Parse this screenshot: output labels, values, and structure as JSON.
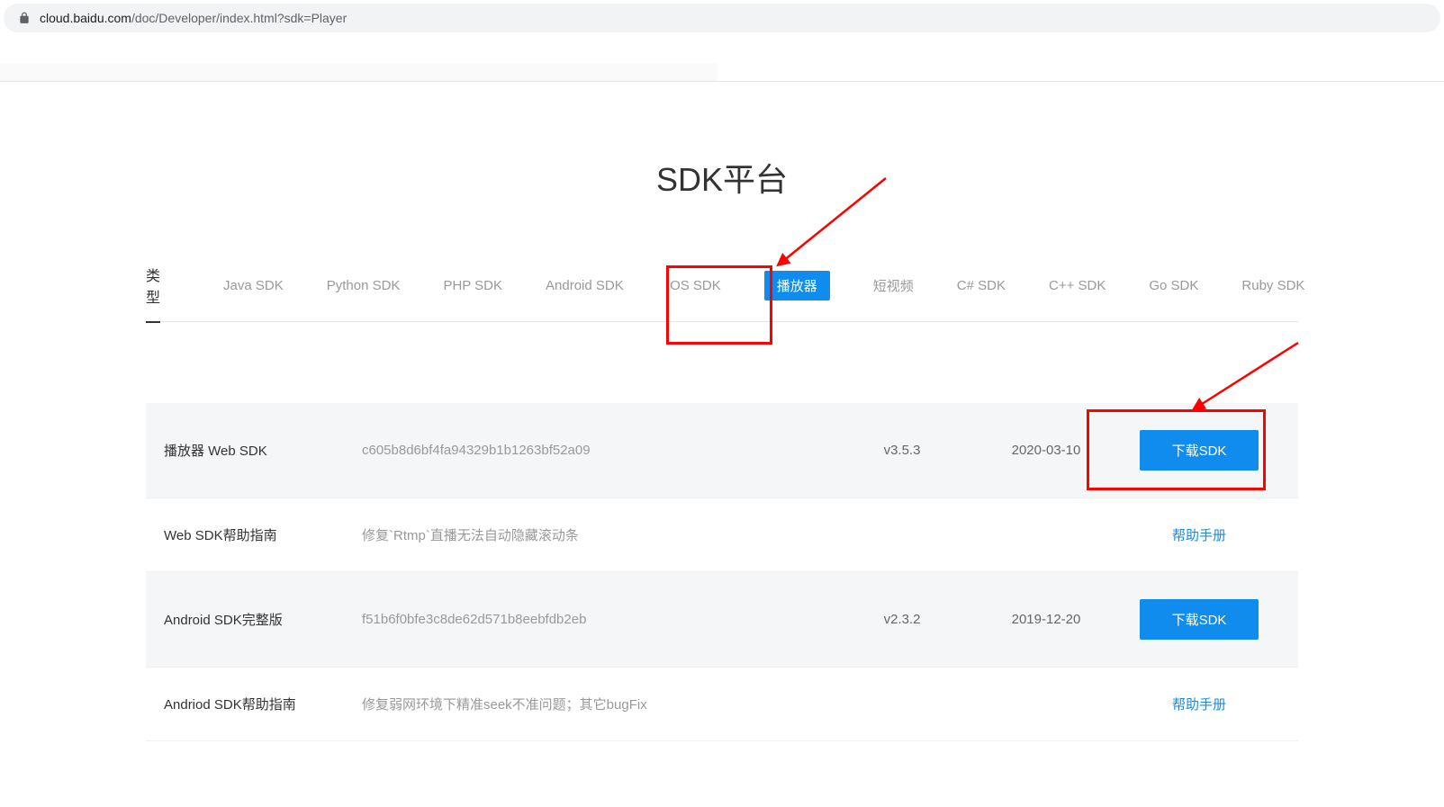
{
  "url": {
    "domain": "cloud.baidu.com",
    "path": "/doc/Developer/index.html?sdk=Player"
  },
  "page_title": "SDK平台",
  "type_label": "类型",
  "type_items": [
    {
      "label": "Java SDK",
      "active": false
    },
    {
      "label": "Python SDK",
      "active": false
    },
    {
      "label": "PHP SDK",
      "active": false
    },
    {
      "label": "Android SDK",
      "active": false
    },
    {
      "label": "iOS SDK",
      "active": false
    },
    {
      "label": "播放器",
      "active": true
    },
    {
      "label": "短视频",
      "active": false
    },
    {
      "label": "C# SDK",
      "active": false
    },
    {
      "label": "C++ SDK",
      "active": false
    },
    {
      "label": "Go SDK",
      "active": false
    },
    {
      "label": "Ruby SDK",
      "active": false
    }
  ],
  "rows": [
    {
      "name": "播放器 Web SDK",
      "desc": "c605b8d6bf4fa94329b1b1263bf52a09",
      "version": "v3.5.3",
      "date": "2020-03-10",
      "action_type": "download",
      "action_label": "下载SDK",
      "highlighted": true
    },
    {
      "name": "Web SDK帮助指南",
      "desc": "修复`Rtmp`直播无法自动隐藏滚动条",
      "version": "",
      "date": "",
      "action_type": "link",
      "action_label": "帮助手册",
      "highlighted": false
    },
    {
      "name": "Android SDK完整版",
      "desc": "f51b6f0bfe3c8de62d571b8eebfdb2eb",
      "version": "v2.3.2",
      "date": "2019-12-20",
      "action_type": "download",
      "action_label": "下载SDK",
      "highlighted": true
    },
    {
      "name": "Andriod SDK帮助指南",
      "desc": "修复弱网环境下精准seek不准问题；其它bugFix",
      "version": "",
      "date": "",
      "action_type": "link",
      "action_label": "帮助手册",
      "highlighted": false
    }
  ]
}
